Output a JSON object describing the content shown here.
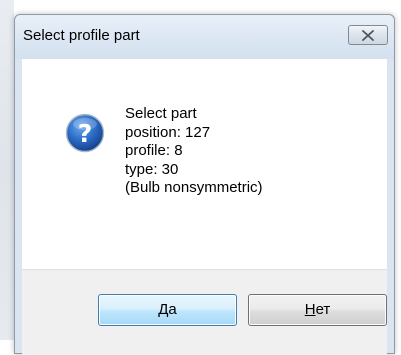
{
  "dialog": {
    "title": "Select profile part",
    "close_icon": "close-icon",
    "question_icon": "question-icon",
    "message_lines": [
      "Select part",
      "position: 127",
      "profile: 8",
      "type: 30",
      "(Bulb nonsymmetric)"
    ],
    "buttons": {
      "yes_label": "Да",
      "no_mnemonic": "Н",
      "no_rest": "ет"
    },
    "colors": {
      "titlebar": "#dbe6f3",
      "icon_blue": "#1f5fb0",
      "default_button_border": "#3c7fb1"
    }
  }
}
